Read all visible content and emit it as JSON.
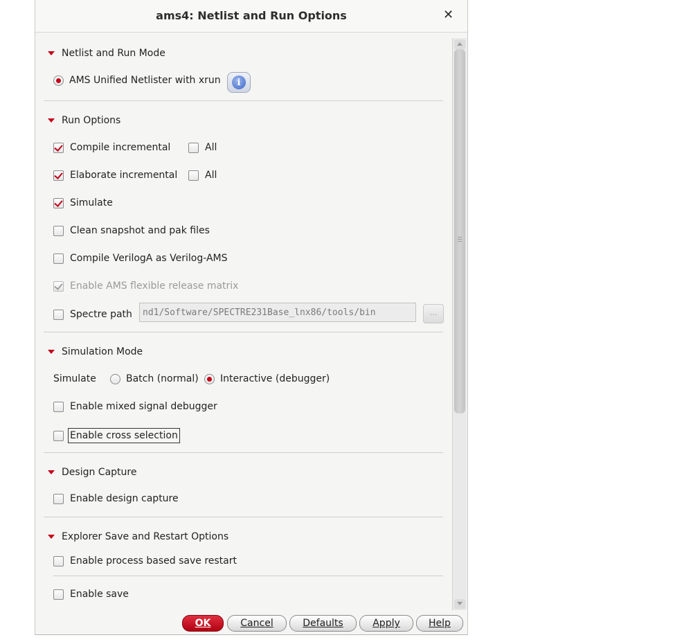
{
  "window": {
    "title": "ams4: Netlist and Run Options"
  },
  "netlist_mode": {
    "heading": "Netlist and Run Mode",
    "option_label": "AMS Unified Netlister with xrun"
  },
  "run_options": {
    "heading": "Run Options",
    "compile_incremental": "Compile incremental",
    "compile_all": "All",
    "elaborate_incremental": "Elaborate incremental",
    "elaborate_all": "All",
    "simulate": "Simulate",
    "clean_snapshot": "Clean snapshot and pak files",
    "compile_veriloga": "Compile VerilogA as Verilog-AMS",
    "enable_ams_matrix": "Enable AMS flexible release matrix",
    "spectre_path_label": "Spectre path",
    "spectre_path_value": "nd1/Software/SPECTRE231Base_lnx86/tools/bin",
    "browse_label": "..."
  },
  "simulation_mode": {
    "heading": "Simulation Mode",
    "simulate_label": "Simulate",
    "batch_label": "Batch (normal)",
    "interactive_label": "Interactive (debugger)",
    "mixed_signal_debugger": "Enable mixed signal debugger",
    "cross_selection": "Enable cross selection"
  },
  "design_capture": {
    "heading": "Design Capture",
    "enable_design_capture": "Enable design capture"
  },
  "explorer_save": {
    "heading": "Explorer Save and Restart Options",
    "process_save_restart": "Enable process based save restart",
    "enable_save": "Enable save"
  },
  "buttons": {
    "ok": "OK",
    "cancel": "Cancel",
    "defaults": "Defaults",
    "apply": "Apply",
    "help": "Help"
  },
  "icons": {
    "close": "close-icon",
    "info": "info-icon",
    "collapse": "triangle-down-icon"
  },
  "colors": {
    "accent": "#c40018",
    "ok_button": "#c8001a"
  }
}
